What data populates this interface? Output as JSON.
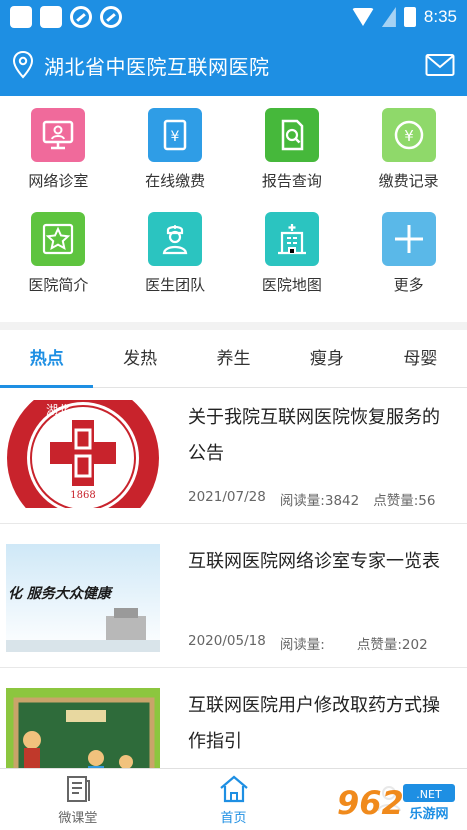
{
  "status": {
    "time": "8:35"
  },
  "header": {
    "title": "湖北省中医院互联网医院"
  },
  "services": [
    {
      "label": "网络诊室",
      "color": "#f06a9b"
    },
    {
      "label": "在线缴费",
      "color": "#2f9de6"
    },
    {
      "label": "报告查询",
      "color": "#46b83b"
    },
    {
      "label": "缴费记录",
      "color": "#8fd96a"
    },
    {
      "label": "医院简介",
      "color": "#5ec43f"
    },
    {
      "label": "医生团队",
      "color": "#2bc4c0"
    },
    {
      "label": "医院地图",
      "color": "#2bc4c0"
    },
    {
      "label": "更多",
      "color": "#5ab8e8"
    }
  ],
  "tabs": [
    "热点",
    "发热",
    "养生",
    "瘦身",
    "母婴"
  ],
  "news": [
    {
      "title": "关于我院互联网医院恢复服务的公告",
      "date": "2021/07/28",
      "reads": "阅读量:3842",
      "likes": "点赞量:56"
    },
    {
      "title": "互联网医院网络诊室专家一览表",
      "date": "2020/05/18",
      "reads": "阅读量:",
      "likes": "点赞量:202"
    },
    {
      "title": "互联网医院用户修改取药方式操作指引",
      "date": "",
      "reads": "",
      "likes": ""
    }
  ],
  "thumbs": {
    "seal_year": "1868",
    "seal_top": "湖北",
    "banner_text": "化  服务大众健康"
  },
  "bottom_nav": [
    {
      "label": "微课堂"
    },
    {
      "label": "首页"
    },
    {
      "label": ""
    }
  ],
  "watermark": {
    "brand": "962",
    "sub": "乐游网"
  }
}
